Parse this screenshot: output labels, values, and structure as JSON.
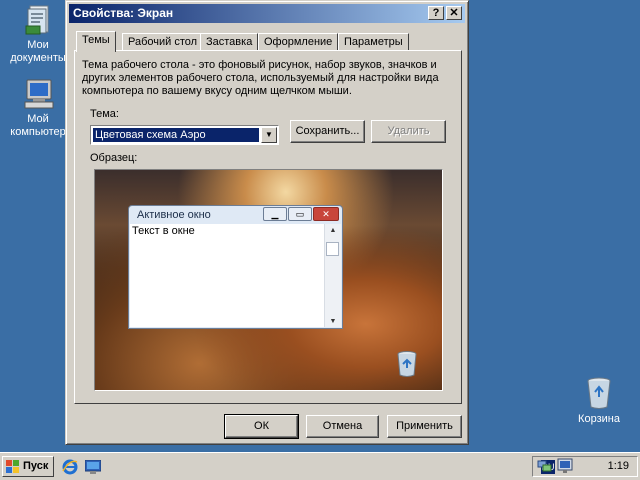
{
  "desktop": {
    "icons": [
      {
        "label_line1": "Мои",
        "label_line2": "документы",
        "icon": "my-documents-icon"
      },
      {
        "label_line1": "Мой",
        "label_line2": "компьютер",
        "icon": "my-computer-icon"
      },
      {
        "label_line1": "Корзина",
        "label_line2": "",
        "icon": "recycle-bin-icon"
      }
    ]
  },
  "dialog": {
    "title": "Свойства: Экран",
    "help_glyph": "?",
    "close_glyph": "✕",
    "tabs": [
      {
        "label": "Темы",
        "active": true
      },
      {
        "label": "Рабочий стол",
        "active": false
      },
      {
        "label": "Заставка",
        "active": false
      },
      {
        "label": "Оформление",
        "active": false
      },
      {
        "label": "Параметры",
        "active": false
      }
    ],
    "description": "Тема рабочего стола - это фоновый рисунок, набор звуков, значков и других элементов рабочего стола, используемый для настройки вида компьютера по вашему вкусу одним щелчком мыши.",
    "theme_label": "Тема:",
    "theme_value": "Цветовая схема Аэро",
    "save_label": "Сохранить...",
    "delete_label": "Удалить",
    "sample_label": "Образец:",
    "preview": {
      "window_title": "Активное окно",
      "window_text": "Текст в окне"
    },
    "ok_label": "ОК",
    "cancel_label": "Отмена",
    "apply_label": "Применить"
  },
  "taskbar": {
    "start_label": "Пуск",
    "lang": "RU",
    "clock": "1:19"
  }
}
